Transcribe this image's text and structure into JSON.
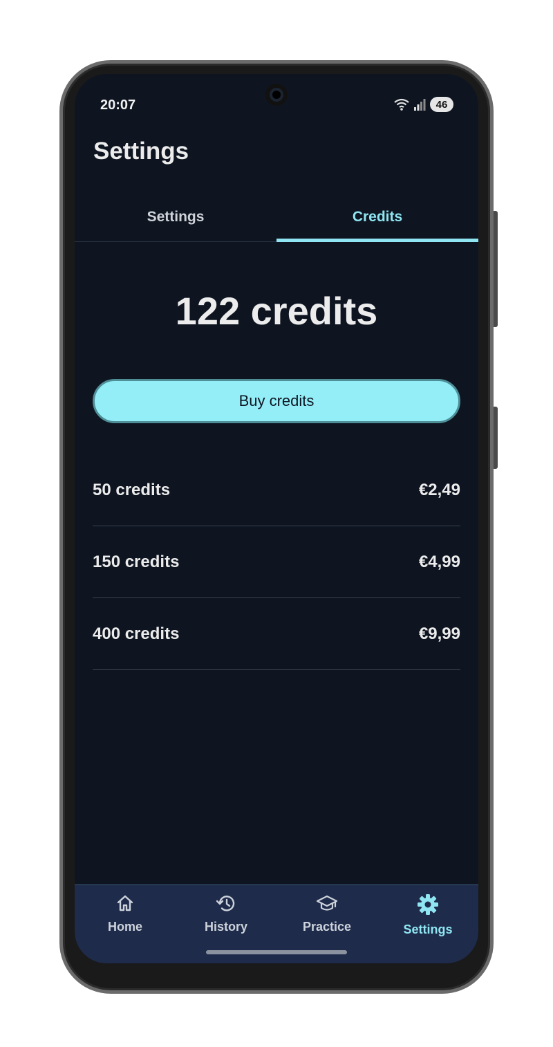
{
  "status_bar": {
    "time": "20:07",
    "battery": "46"
  },
  "header": {
    "title": "Settings"
  },
  "tabs": [
    {
      "label": "Settings",
      "active": false
    },
    {
      "label": "Credits",
      "active": true
    }
  ],
  "credits": {
    "balance": "122 credits",
    "buy_label": "Buy credits"
  },
  "packages": [
    {
      "name": "50 credits",
      "price": "€2,49"
    },
    {
      "name": "150 credits",
      "price": "€4,99"
    },
    {
      "name": "400 credits",
      "price": "€9,99"
    }
  ],
  "bottom_nav": [
    {
      "label": "Home",
      "icon": "home-icon",
      "active": false
    },
    {
      "label": "History",
      "icon": "history-icon",
      "active": false
    },
    {
      "label": "Practice",
      "icon": "graduation-cap-icon",
      "active": false
    },
    {
      "label": "Settings",
      "icon": "gear-icon",
      "active": true
    }
  ],
  "colors": {
    "background": "#0e1521",
    "accent": "#8fe6f2",
    "button": "#93eef8",
    "nav_background": "#1f2b4a"
  }
}
